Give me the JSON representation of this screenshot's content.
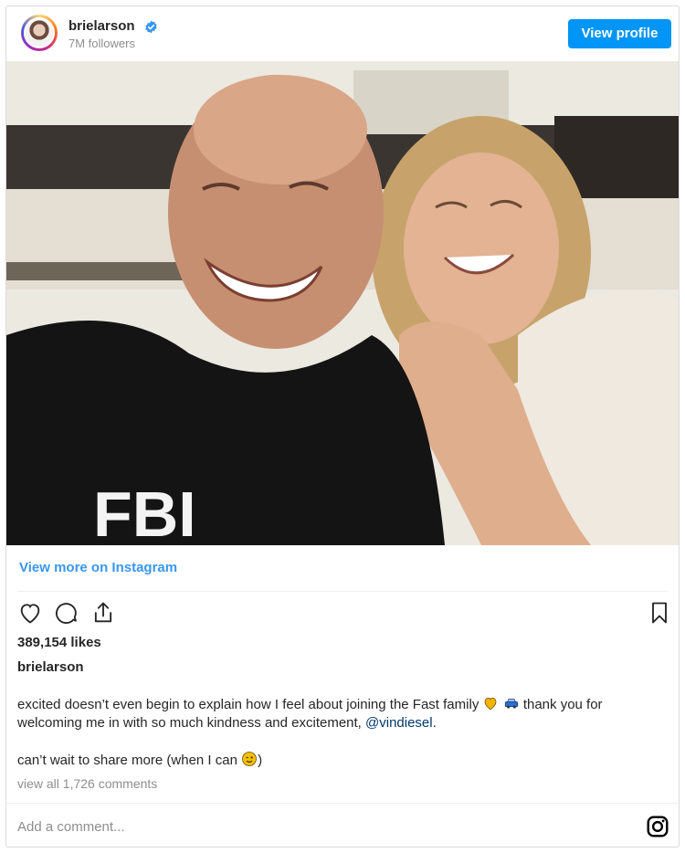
{
  "header": {
    "username": "brielarson",
    "followers": "7M followers",
    "view_profile_label": "View profile"
  },
  "links": {
    "view_more": "View more on Instagram"
  },
  "post": {
    "likes": "389,154 likes",
    "caption_user": "brielarson",
    "caption_part1": "excited doesn’t even begin to explain how I feel about joining the Fast family",
    "caption_part2": "thank you for welcoming me in with so much kindness and excitement,",
    "mention": "@vindiesel",
    "caption_end": ".",
    "caption_line2": "can’t wait to share more (when I can",
    "caption_line2_end": ")",
    "view_comments": "view all 1,726 comments"
  },
  "comment": {
    "placeholder": "Add a comment..."
  },
  "icons": {
    "verified": "verified-badge-icon",
    "like": "heart-icon",
    "comment": "comment-bubble-icon",
    "share": "share-icon",
    "save": "bookmark-icon",
    "instagram": "instagram-logo-icon"
  },
  "colors": {
    "accent": "#0095f6",
    "link": "#3897f0",
    "mention": "#00376b"
  }
}
